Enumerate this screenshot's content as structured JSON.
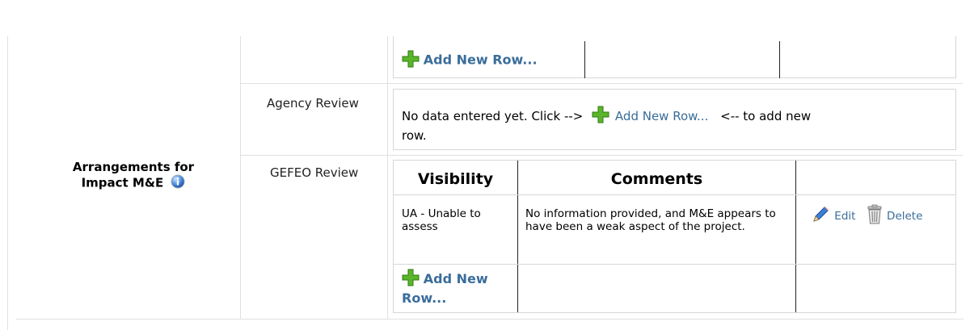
{
  "section": {
    "title": "Arrangements for Impact M&E"
  },
  "top_table": {
    "add_new_row": "Add New Row..."
  },
  "agency_review": {
    "label": "Agency Review",
    "message_prefix": "No data entered yet. Click -->",
    "add_new_row": "Add New Row...",
    "message_suffix": "<-- to add new",
    "message_suffix2": "row."
  },
  "gefeo_review": {
    "label": "GEFEO Review",
    "headers": [
      "Visibility",
      "Comments",
      ""
    ],
    "rows": [
      {
        "visibility": "UA - Unable to assess",
        "comments": "No information provided, and M&E appears to have been a weak aspect of the project.",
        "edit": "Edit",
        "delete": "Delete"
      }
    ],
    "add_new_row": "Add New Row..."
  },
  "colors": {
    "link": "#3a6d9a",
    "plus_green": "#5bb52a",
    "info_blue": "#2f6fd1"
  }
}
